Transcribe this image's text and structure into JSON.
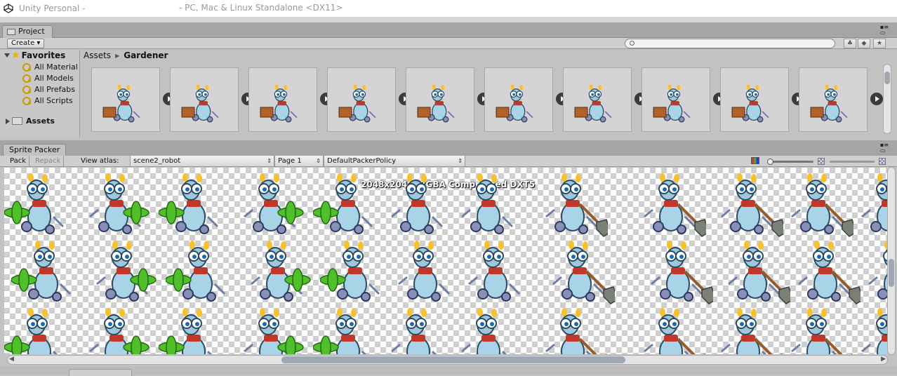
{
  "window": {
    "app_title": "Unity Personal -",
    "platform_title": "- PC, Mac & Linux Standalone <DX11>"
  },
  "project": {
    "tab_label": "Project",
    "create_label": "Create",
    "favorites_label": "Favorites",
    "favorites": [
      "All Material",
      "All Models",
      "All Prefabs",
      "All Scripts"
    ],
    "assets_label": "Assets",
    "breadcrumb": [
      "Assets",
      "Gardener"
    ],
    "thumbnail_count": 10
  },
  "sprite_packer": {
    "tab_label": "Sprite Packer",
    "pack_label": "Pack",
    "repack_label": "Repack",
    "view_atlas_label": "View atlas:",
    "atlas_value": "scene2_robot",
    "page_value": "Page 1",
    "policy_value": "DefaultPackerPolicy",
    "atlas_info": "2048x2048, RGBA Compressed DXT5"
  },
  "colors": {
    "robot_body": "#a9d3e6",
    "robot_outline": "#2b4a63",
    "propeller_green": "#4fbf2a",
    "bulb_yellow": "#f6c12a",
    "scarf_red": "#c1372a",
    "shovel_grey": "#7b8076",
    "handle_brown": "#9a5a26"
  }
}
